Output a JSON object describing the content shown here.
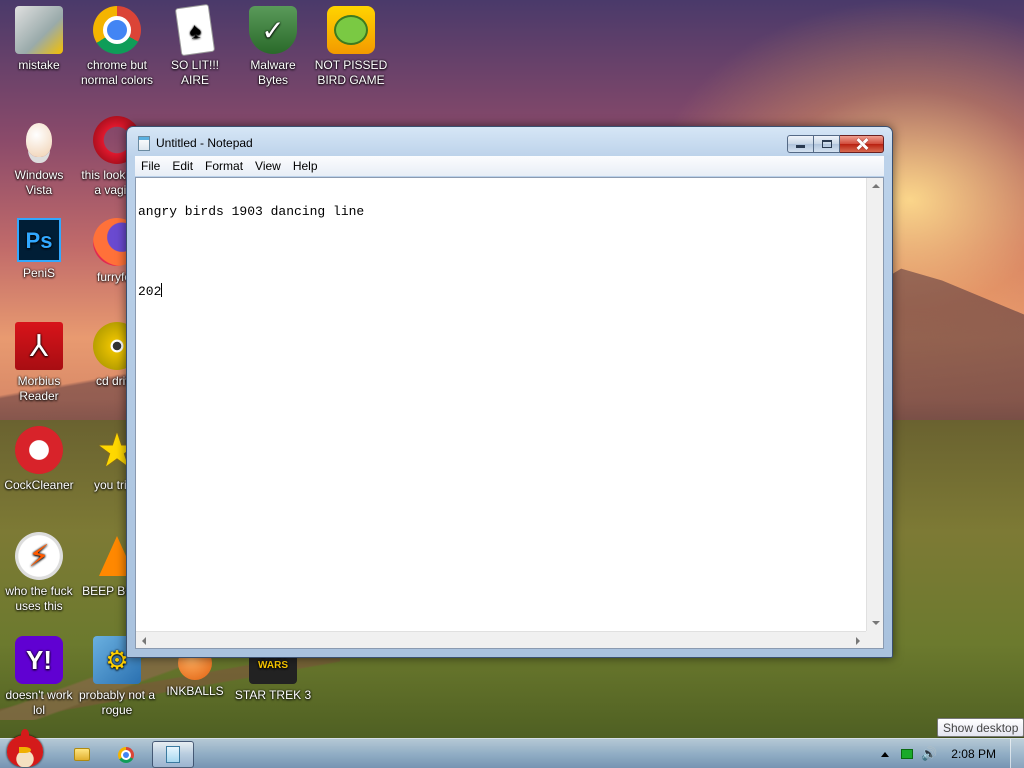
{
  "desktop": {
    "icons": [
      {
        "label": "mistake",
        "icon": "program-installer-icon"
      },
      {
        "label": "chrome but normal colors",
        "icon": "chrome-icon"
      },
      {
        "label": "SO LIT!!! AIRE",
        "icon": "solitaire-cards-icon"
      },
      {
        "label": "Malware Bytes",
        "icon": "shield-check-icon"
      },
      {
        "label": "NOT PISSED BIRD GAME",
        "icon": "green-pig-icon"
      },
      {
        "label": "Windows Vista",
        "icon": "egg-icon"
      },
      {
        "label": "this looks like a vagina",
        "icon": "opera-icon"
      },
      {
        "label": "PeniS",
        "icon": "photoshop-icon"
      },
      {
        "label": "furryfox",
        "icon": "firefox-icon"
      },
      {
        "label": "Morbius Reader",
        "icon": "acrobat-icon"
      },
      {
        "label": "cd drive",
        "icon": "cd-icon"
      },
      {
        "label": "CockCleaner",
        "icon": "ccleaner-icon"
      },
      {
        "label": "you tried",
        "icon": "star-icon"
      },
      {
        "label": "who the fuck uses this",
        "icon": "lightning-bolt-icon"
      },
      {
        "label": "BEEP BOOP",
        "icon": "vlc-cone-icon"
      },
      {
        "label": "doesn't work lol",
        "icon": "yahoo-messenger-icon"
      },
      {
        "label": "probably not a rogue",
        "icon": "gears-icon"
      },
      {
        "label": "INKBALLS",
        "icon": "orange-ball-icon"
      },
      {
        "label": "STAR TREK 3",
        "icon": "star-wars-icon"
      }
    ]
  },
  "notepad": {
    "title": "Untitled - Notepad",
    "menu": [
      "File",
      "Edit",
      "Format",
      "View",
      "Help"
    ],
    "lines": [
      "angry birds 1903 dancing line",
      "",
      "202"
    ],
    "buttons": {
      "minimize": "minimize",
      "maximize": "maximize",
      "close": "close"
    }
  },
  "taskbar": {
    "start_icon": "angry-bird-icon",
    "pinned": [
      "folder-icon",
      "chrome-icon",
      "notepad-icon"
    ],
    "clock": "2:08 PM",
    "tooltip": "Show desktop"
  },
  "colors": {
    "close_button": "#c8321e",
    "taskbar": "#96b4d2",
    "window_frame": "#bcd2ea"
  }
}
